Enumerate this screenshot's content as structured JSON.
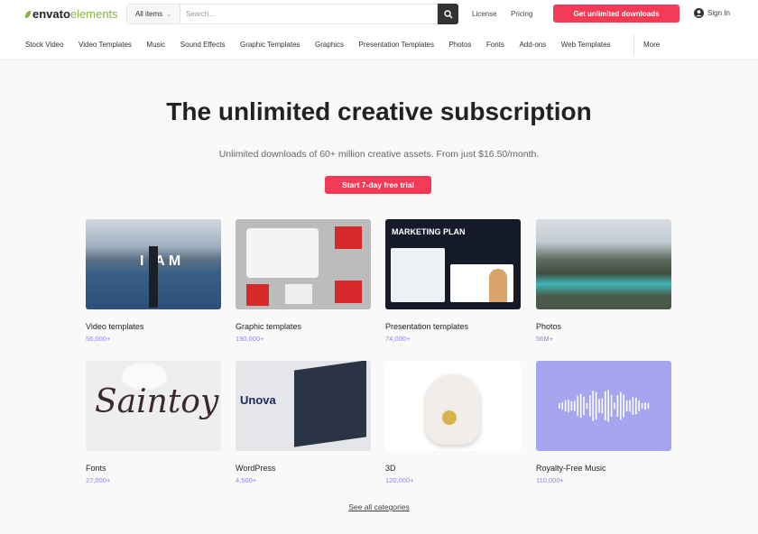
{
  "header": {
    "logo": {
      "brand": "envato",
      "product": "elements"
    },
    "category_select": "All items",
    "search_placeholder": "Search...",
    "links": [
      "License",
      "Pricing"
    ],
    "cta": "Get unlimited downloads",
    "sign_in": "Sign In",
    "accent": "#f33b57"
  },
  "nav": {
    "items": [
      "Stock Video",
      "Video Templates",
      "Music",
      "Sound Effects",
      "Graphic Templates",
      "Graphics",
      "Presentation Templates",
      "Photos",
      "Fonts",
      "Add-ons",
      "Web Templates"
    ],
    "more": "More"
  },
  "hero": {
    "title": "The unlimited creative subscription",
    "subtitle": "Unlimited downloads of 60+ million creative assets. From just $16.50/month.",
    "button": "Start 7-day free trial"
  },
  "categories": [
    {
      "label": "Video templates",
      "count": "56,000+",
      "thumb_text": "I AM"
    },
    {
      "label": "Graphic templates",
      "count": "190,000+"
    },
    {
      "label": "Presentation templates",
      "count": "74,000+",
      "thumb_text": "MARKETING PLAN"
    },
    {
      "label": "Photos",
      "count": "56M+"
    },
    {
      "label": "Fonts",
      "count": "27,000+",
      "thumb_text": "Saintoy"
    },
    {
      "label": "WordPress",
      "count": "4,500+",
      "thumb_text": "Unova"
    },
    {
      "label": "3D",
      "count": "120,000+"
    },
    {
      "label": "Royalty-Free Music",
      "count": "110,000+"
    }
  ],
  "see_all": "See all categories"
}
